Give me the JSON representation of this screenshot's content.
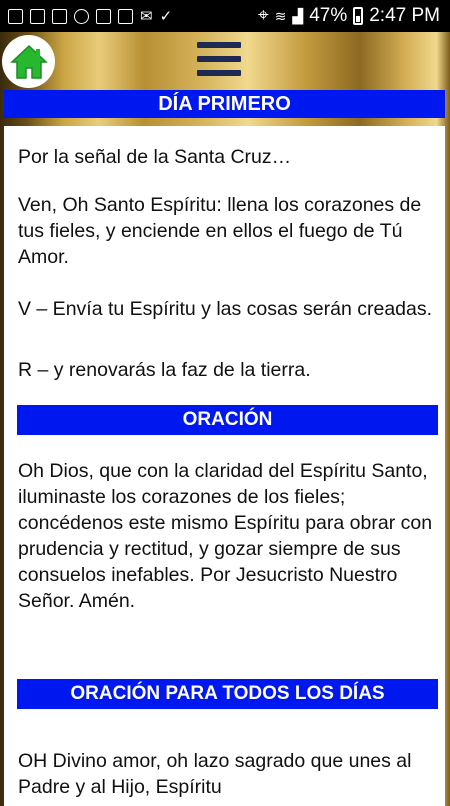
{
  "status_bar": {
    "battery_percent": "47%",
    "time": "2:47 PM",
    "icons": [
      "image-icon",
      "mail-icon",
      "gallery-icon",
      "sync-icon",
      "app-icon",
      "email-icon",
      "mail-icon",
      "check-icon",
      "location-icon",
      "wifi-icon",
      "signal-icon",
      "battery-icon"
    ]
  },
  "toolbar": {
    "home_icon": "home-icon",
    "menu_icon": "hamburger-menu-icon",
    "colors": {
      "home_green": "#27b82f",
      "menu_navy": "#1f2a52"
    }
  },
  "header": {
    "title": "DÍA PRIMERO",
    "color": "#0018f0"
  },
  "content": {
    "p1": "Por la señal de la Santa Cruz…",
    "p2": "Ven, Oh Santo Espíritu: llena los corazones de tus fieles, y enciende en ellos el fuego de Tú Amor.",
    "p3": "V – Envía tu Espíritu y las cosas serán creadas.",
    "p4": "R – y renovarás la faz de la tierra.",
    "section1_title": "ORACIÓN",
    "p5": "Oh Dios, que con la claridad del Espíritu Santo, iluminaste los corazones de los fieles; concédenos este mismo Espíritu para obrar con prudencia y rectitud, y gozar siempre de sus consuelos inefables. Por Jesucristo Nuestro Señor. Amén.",
    "section2_title": "ORACIÓN PARA TODOS LOS DÍAS",
    "p6": "OH Divino amor, oh lazo sagrado que unes al Padre y al Hijo, Espíritu"
  }
}
